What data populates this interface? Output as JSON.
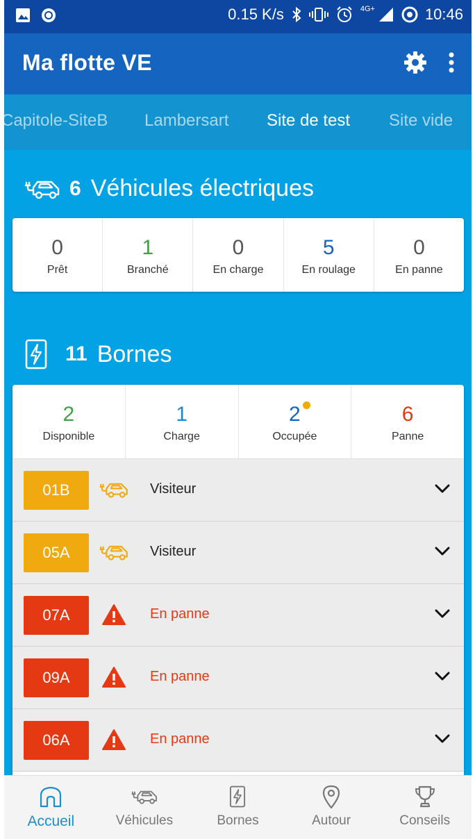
{
  "status_bar": {
    "speed": "0.15 K/s",
    "network": "4G+",
    "time": "10:46"
  },
  "app": {
    "title": "Ma flotte VE"
  },
  "tabs": [
    {
      "label": "Capitole-SiteB",
      "active": false
    },
    {
      "label": "Lambersart",
      "active": false
    },
    {
      "label": "Site de test",
      "active": true
    },
    {
      "label": "Site vide",
      "active": false
    }
  ],
  "vehicles": {
    "count": "6",
    "title": "Véhicules électriques",
    "stats": [
      {
        "value": "0",
        "label": "Prêt",
        "color": "#555555"
      },
      {
        "value": "1",
        "label": "Branché",
        "color": "#43a047"
      },
      {
        "value": "0",
        "label": "En charge",
        "color": "#555555"
      },
      {
        "value": "5",
        "label": "En roulage",
        "color": "#1565c0"
      },
      {
        "value": "0",
        "label": "En panne",
        "color": "#555555"
      }
    ]
  },
  "bornes": {
    "count": "11",
    "title": "Bornes",
    "stats": [
      {
        "value": "2",
        "label": "Disponible",
        "color": "#43a047"
      },
      {
        "value": "1",
        "label": "Charge",
        "color": "#1e88c9"
      },
      {
        "value": "2",
        "label": "Occupée",
        "color": "#1565c0"
      },
      {
        "value": "6",
        "label": "Panne",
        "color": "#e53914"
      }
    ],
    "rows": [
      {
        "id": "01B",
        "status_label": "Visiteur",
        "badge_color": "#f0a90e",
        "icon": "car-plug-icon",
        "label_color": "#222222"
      },
      {
        "id": "05A",
        "status_label": "Visiteur",
        "badge_color": "#f0a90e",
        "icon": "car-plug-icon",
        "label_color": "#222222"
      },
      {
        "id": "07A",
        "status_label": "En panne",
        "badge_color": "#e53914",
        "icon": "warning-icon",
        "label_color": "#e53914"
      },
      {
        "id": "09A",
        "status_label": "En panne",
        "badge_color": "#e53914",
        "icon": "warning-icon",
        "label_color": "#e53914"
      },
      {
        "id": "06A",
        "status_label": "En panne",
        "badge_color": "#e53914",
        "icon": "warning-icon",
        "label_color": "#e53914"
      }
    ]
  },
  "bottom_nav": [
    {
      "label": "Accueil",
      "icon": "home-icon",
      "active": true
    },
    {
      "label": "Véhicules",
      "icon": "car-plug-icon",
      "active": false
    },
    {
      "label": "Bornes",
      "icon": "charger-icon",
      "active": false
    },
    {
      "label": "Autour",
      "icon": "location-pin-icon",
      "active": false
    },
    {
      "label": "Conseils",
      "icon": "trophy-icon",
      "active": false
    }
  ],
  "colors": {
    "status_bar": "#0d47a1",
    "app_bar": "#1565c0",
    "tabs_bg": "#1393cf",
    "content_bg": "#03a2e4",
    "accent": "#1a8fd0",
    "warning": "#e53914",
    "visitor": "#f0a90e"
  }
}
